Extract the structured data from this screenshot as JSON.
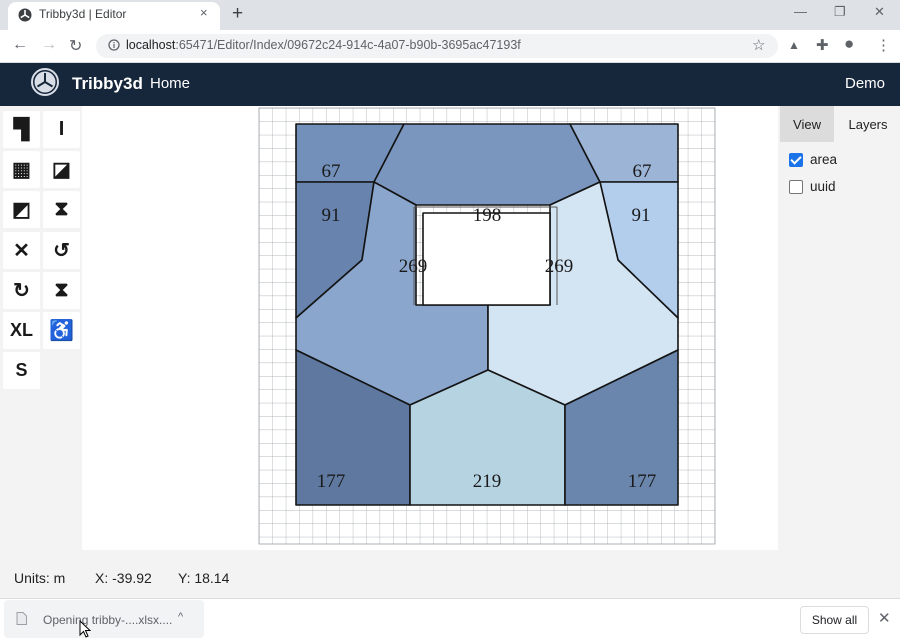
{
  "browser": {
    "tab_title": "Tribby3d | Editor",
    "tab_close_icon": "×",
    "new_tab_icon": "+",
    "url_host": "localhost",
    "url_rest": ":65471/Editor/Index/09672c24-914c-4a07-b90b-3695ac47193f",
    "icons": {
      "back": "←",
      "forward": "→",
      "reload": "↻",
      "star": "☆",
      "drive": "▲",
      "extensions": "✚",
      "profile": "●",
      "menu": "⋮",
      "minimize": "—",
      "restore": "❐",
      "close": "✕"
    }
  },
  "app": {
    "brand": "Tribby3d",
    "nav_home": "Home",
    "nav_user": "Demo",
    "navbar_color": "#16263b"
  },
  "tools": [
    {
      "name": "wall-corner-tool",
      "glyph": "▜"
    },
    {
      "name": "wall-vertical-tool",
      "glyph": "I"
    },
    {
      "name": "brick-wall-tool",
      "glyph": "▦"
    },
    {
      "name": "split-room-tool",
      "glyph": "◪"
    },
    {
      "name": "merge-area-tool",
      "glyph": "◩"
    },
    {
      "name": "insert-section-tool",
      "glyph": "⧗"
    },
    {
      "name": "delete-tool",
      "glyph": "✕"
    },
    {
      "name": "rotate-ccw-tool",
      "glyph": "↺"
    },
    {
      "name": "rotate-cw-tool",
      "glyph": "↻"
    },
    {
      "name": "flip-vertical-tool",
      "glyph": "⧗"
    },
    {
      "name": "export-xl-tool",
      "glyph": "XL"
    },
    {
      "name": "toilet-tool",
      "glyph": "♿"
    },
    {
      "name": "save-tool",
      "glyph": "S"
    }
  ],
  "floorplan": {
    "labels": {
      "room_top_left": "67",
      "room_top_right": "67",
      "room_upper_left": "91",
      "room_upper_right": "91",
      "core_top": "198",
      "core_left": "269",
      "core_right": "269",
      "room_bottom_left": "177",
      "room_bottom_center": "219",
      "room_bottom_right": "177"
    }
  },
  "right_panel": {
    "tab_view": "View",
    "tab_layers": "Layers",
    "options": [
      {
        "label": "area",
        "checked": true
      },
      {
        "label": "uuid",
        "checked": false
      }
    ]
  },
  "status": {
    "units": "Units: m",
    "x": "X: -39.92",
    "y": "Y: 18.14"
  },
  "download": {
    "text": "Opening tribby-....xlsx....",
    "chevron": "^",
    "show_all": "Show all",
    "close_icon": "✕"
  }
}
